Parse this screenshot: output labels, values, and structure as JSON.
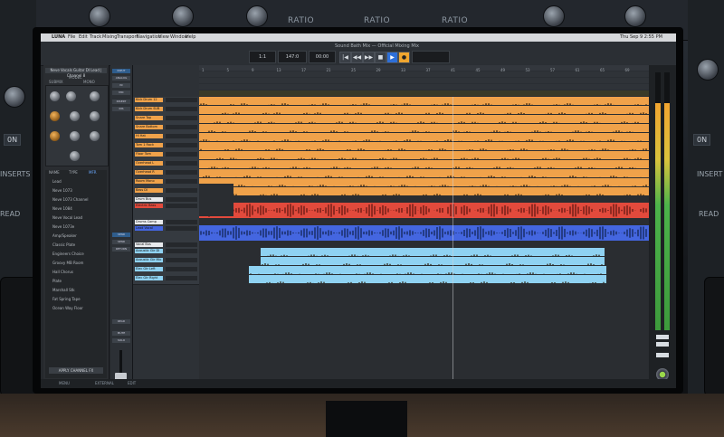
{
  "background": {
    "rack_labels": [
      "RATIO",
      "RATIO",
      "RATIO"
    ],
    "left_side": {
      "value": "0N",
      "inserts": "INSERTS",
      "read": "READ"
    },
    "right_side": {
      "value": "0N",
      "inserts": "INSERT",
      "read": "READ"
    }
  },
  "menubar": {
    "app_name": "LUNA",
    "items": [
      "File",
      "Edit",
      "Track",
      "Mixing",
      "Transport",
      "Navigation",
      "View",
      "Window",
      "Help"
    ],
    "clock": "Thu Sep 9  2:55 PM"
  },
  "toolbar": {
    "title": "Sound Bath Mix — Official Mixing Mix",
    "counter_left": "1:1",
    "counter_mid": "147:0",
    "counter_right": "00:00",
    "transport": [
      "|◀",
      "◀◀",
      "▶▶",
      "■",
      "▶",
      "●"
    ]
  },
  "left_panel": {
    "header": "Neve Vocals Guitar DI Lead | Channel 8",
    "model_label": "MODEL",
    "sub_labels": [
      "SUBMIX",
      "MONO",
      "1073",
      "1084"
    ],
    "tabs": [
      "NAME",
      "TYPE",
      "MFR"
    ],
    "plugins": [
      "Lead",
      "Neve 1073",
      "Neve 1073 Channel",
      "Neve 1084",
      "Neve Vocal Lead",
      "Neve 1073e",
      "Amp/Speaker",
      "Classic Plate",
      "Engineers Choice",
      "Groovy MB Room",
      "Hall Chorus",
      "Plate",
      "Marshall Stk",
      "Fat Spring Tape",
      "Ocean Way Floor"
    ],
    "footer": "APPLY CHANNEL FX"
  },
  "strip": {
    "buttons": [
      "INPUT",
      "ANALOG",
      "IN",
      "MIC",
      "INSERT",
      "INS",
      "SEND",
      "SEND",
      "RETURN",
      "READ",
      "MUTE",
      "SOLO"
    ]
  },
  "ruler": {
    "lanes": [
      "MARK",
      "TEMPO",
      "SIGNATURE",
      "KEY",
      "SESSION",
      "REGIONS"
    ],
    "ticks": [
      "1",
      "5",
      "9",
      "13",
      "17",
      "21",
      "25",
      "29",
      "33",
      "37",
      "41",
      "45",
      "49",
      "53",
      "57",
      "61",
      "65",
      "69"
    ]
  },
  "tracks": [
    {
      "name": "Kick Drum 12",
      "color": "#f0a24a"
    },
    {
      "name": "Kick Drum SUB",
      "color": "#f0a24a"
    },
    {
      "name": "Snare Top",
      "color": "#f0a24a"
    },
    {
      "name": "Snare Bottom",
      "color": "#f0a24a"
    },
    {
      "name": "Hi Hat",
      "color": "#f0a24a"
    },
    {
      "name": "Tom 1 Rack",
      "color": "#f0a24a"
    },
    {
      "name": "Floor Tom",
      "color": "#f0a24a"
    },
    {
      "name": "Overhead L",
      "color": "#f0a24a"
    },
    {
      "name": "Overhead R",
      "color": "#f0a24a"
    },
    {
      "name": "Room Mono",
      "color": "#f0a24a"
    },
    {
      "name": "Bass DI",
      "color": "#f0a24a"
    },
    {
      "name": "Drum Bus",
      "color": "#e8eaed"
    },
    {
      "name": "Electric Bass",
      "color": "#e24a3c"
    },
    {
      "name": "Drums Comp",
      "color": "#e8eaed"
    },
    {
      "name": "Lead Vocal",
      "color": "#4466e0"
    },
    {
      "name": "Vocal Bus",
      "color": "#e8eaed"
    },
    {
      "name": "Acoustic Gtr DI",
      "color": "#8fd2f2"
    },
    {
      "name": "Acoustic Gtr Mic",
      "color": "#8fd2f2"
    },
    {
      "name": "Elec Gtr Left",
      "color": "#8fd2f2"
    },
    {
      "name": "Elec Gtr Right",
      "color": "#8fd2f2"
    }
  ],
  "colors": {
    "orange": "#f0a24a",
    "red": "#e24a3c",
    "blue": "#4466e0",
    "light_blue": "#8fd2f2"
  },
  "status": {
    "left": "MENU",
    "mid": "EXTERNAL",
    "right": "EDIT"
  }
}
